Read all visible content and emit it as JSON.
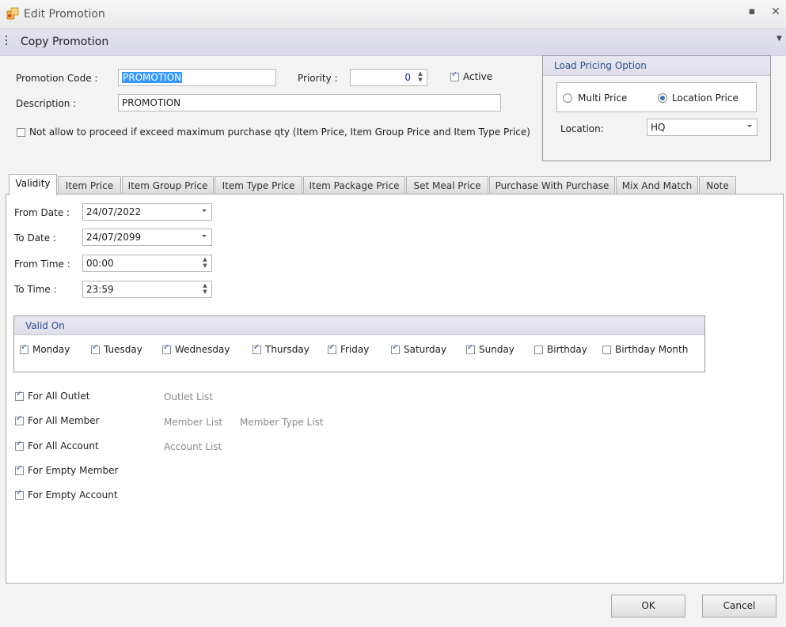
{
  "window": {
    "title": "Edit Promotion",
    "minimize_glyph": "▪",
    "close_glyph": "✕"
  },
  "toolbar": {
    "copy_label": "Copy Promotion"
  },
  "form": {
    "promotion_code_label": "Promotion Code :",
    "promotion_code_value": "PROMOTION",
    "priority_label": "Priority :",
    "priority_value": "0",
    "active_label": "Active",
    "active_checked": true,
    "description_label": "Description :",
    "description_value": "PROMOTION",
    "not_allow_label": "Not allow to proceed if exceed maximum purchase qty (Item Price, Item Group Price and Item Type Price)",
    "not_allow_checked": false
  },
  "load_pricing": {
    "title": "Load Pricing Option",
    "multi_price_label": "Multi Price",
    "location_price_label": "Location Price",
    "selected": "Location Price",
    "location_label": "Location:",
    "location_value": "HQ"
  },
  "tabs": [
    {
      "label": "Validity",
      "active": true
    },
    {
      "label": "Item Price"
    },
    {
      "label": "Item Group Price"
    },
    {
      "label": "Item Type Price"
    },
    {
      "label": "Item Package Price"
    },
    {
      "label": "Set Meal Price"
    },
    {
      "label": "Purchase With Purchase"
    },
    {
      "label": "Mix And Match"
    },
    {
      "label": "Note"
    }
  ],
  "validity": {
    "from_date_label": "From Date :",
    "from_date_value": "24/07/2022",
    "to_date_label": "To Date :",
    "to_date_value": "24/07/2099",
    "from_time_label": "From Time :",
    "from_time_value": "00:00",
    "to_time_label": "To Time :",
    "to_time_value": "23:59",
    "valid_on_title": "Valid On",
    "days": [
      {
        "label": "Monday",
        "checked": true
      },
      {
        "label": "Tuesday",
        "checked": true
      },
      {
        "label": "Wednesday",
        "checked": true
      },
      {
        "label": "Thursday",
        "checked": true
      },
      {
        "label": "Friday",
        "checked": true
      },
      {
        "label": "Saturday",
        "checked": true
      },
      {
        "label": "Sunday",
        "checked": true
      },
      {
        "label": "Birthday",
        "checked": false
      },
      {
        "label": "Birthday Month",
        "checked": false
      }
    ],
    "options": [
      {
        "label": "For All Outlet",
        "checked": true
      },
      {
        "label": "For All Member",
        "checked": true
      },
      {
        "label": "For All Account",
        "checked": true
      },
      {
        "label": "For Empty Member",
        "checked": true
      },
      {
        "label": "For Empty Account",
        "checked": true
      }
    ],
    "links": {
      "outlet_list": "Outlet List",
      "member_list": "Member List",
      "member_type_list": "Member Type List",
      "account_list": "Account List"
    }
  },
  "footer": {
    "ok_label": "OK",
    "cancel_label": "Cancel"
  }
}
